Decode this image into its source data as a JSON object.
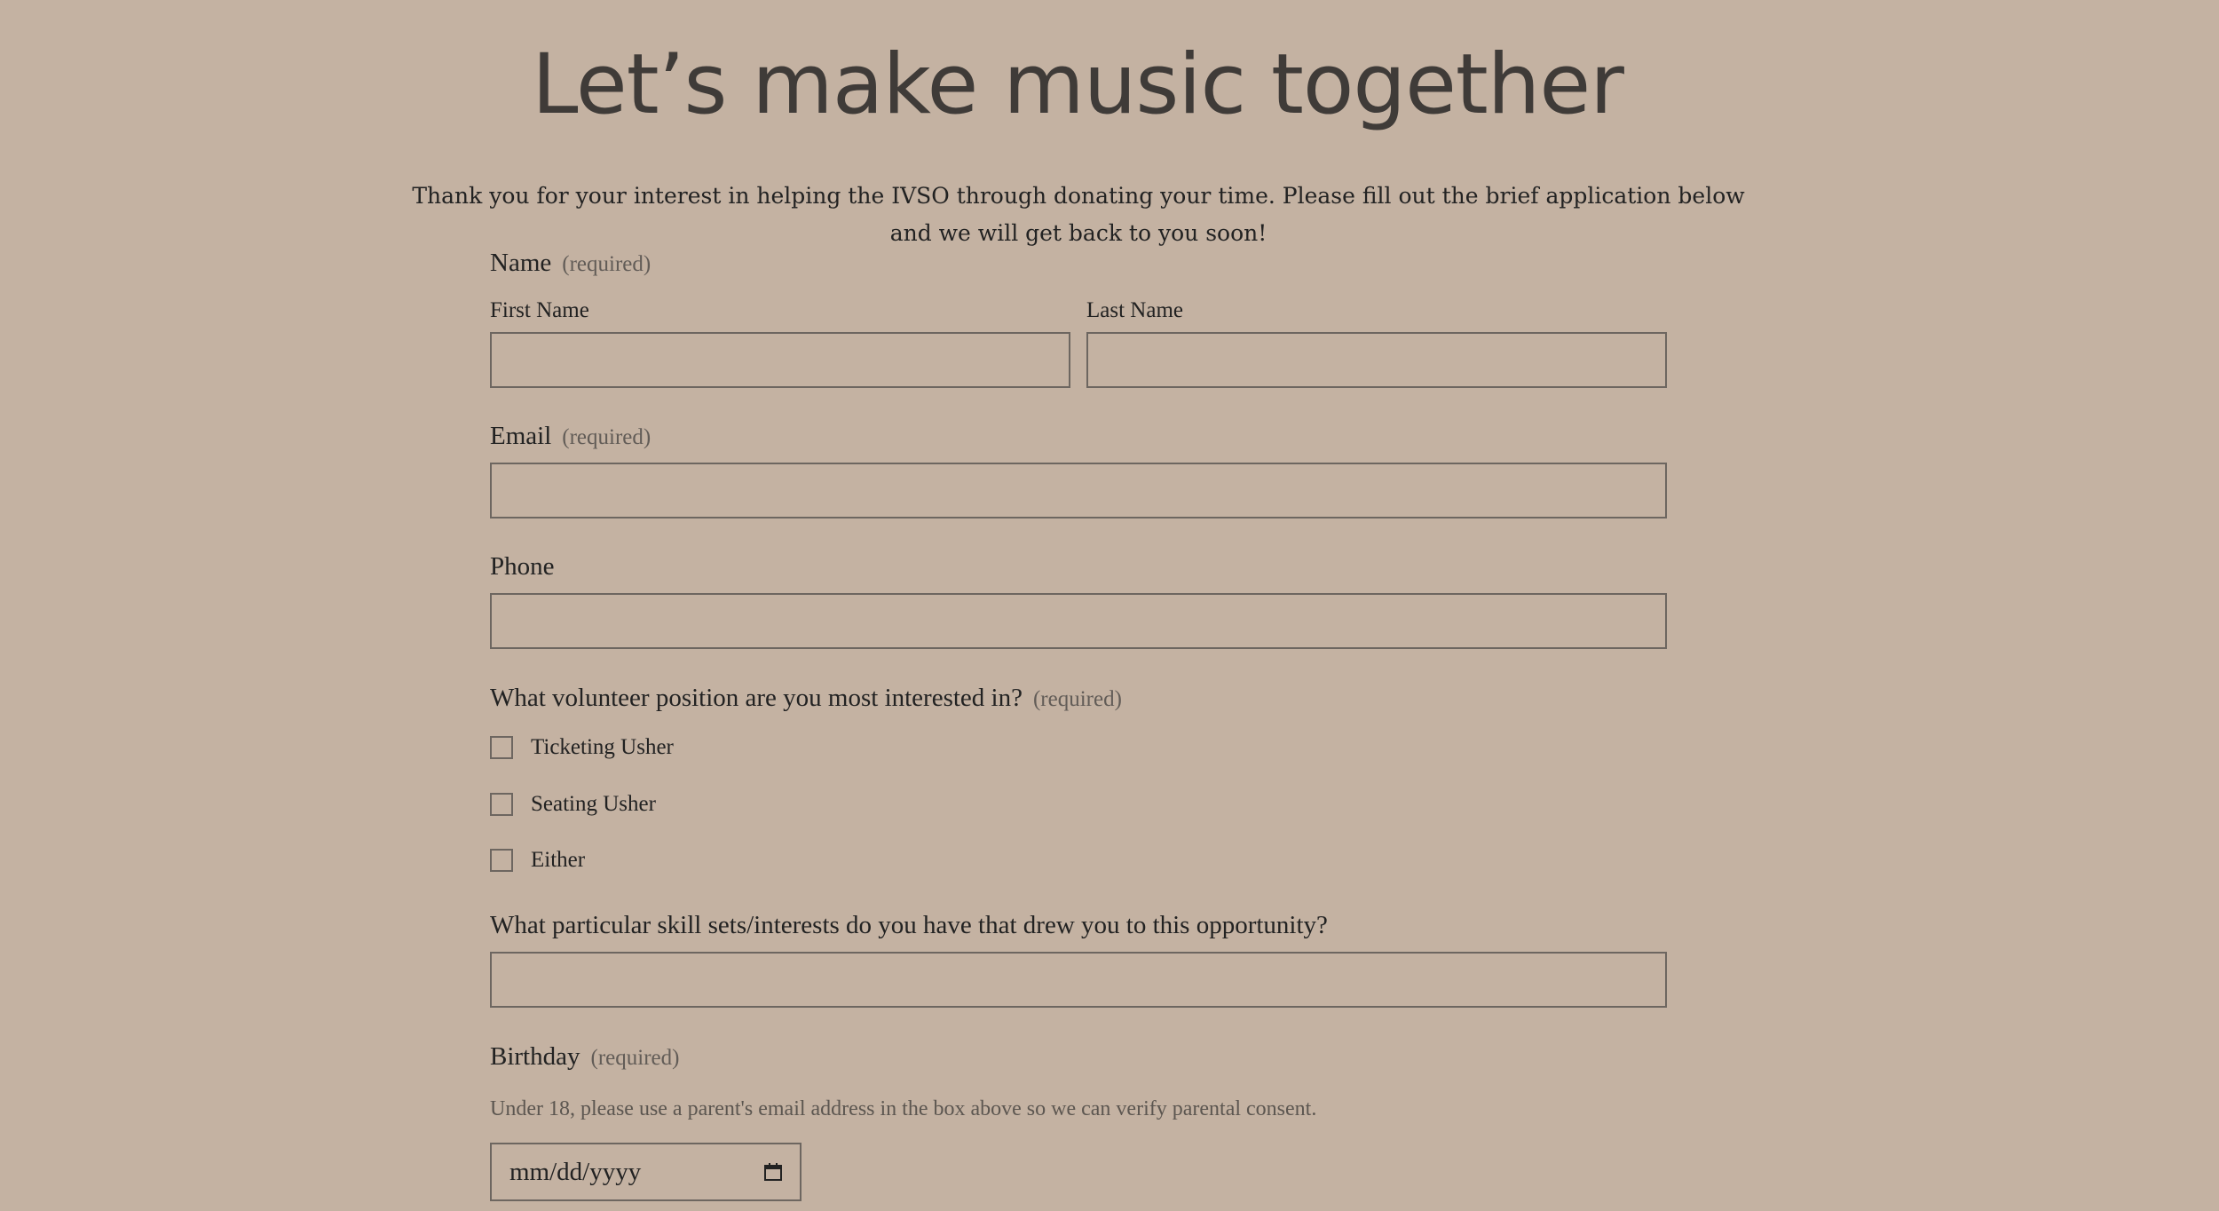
{
  "page": {
    "title": "Let’s make music together",
    "intro": "Thank you for your interest in helping the IVSO through donating your time. Please fill out the brief application below and we will get back to you soon!"
  },
  "form": {
    "required_text": "(required)",
    "name": {
      "label": "Name",
      "first_label": "First Name",
      "first_value": "",
      "last_label": "Last Name",
      "last_value": ""
    },
    "email": {
      "label": "Email",
      "value": ""
    },
    "phone": {
      "label": "Phone",
      "value": ""
    },
    "position": {
      "label": "What volunteer position are you most interested in?",
      "options": [
        {
          "label": "Ticketing Usher",
          "checked": false
        },
        {
          "label": "Seating Usher",
          "checked": false
        },
        {
          "label": "Either",
          "checked": false
        }
      ]
    },
    "skills": {
      "label": "What particular skill sets/interests do you have that drew you to this opportunity?",
      "value": ""
    },
    "birthday": {
      "label": "Birthday",
      "help": "Under 18, please use a parent's email address in the box above so we can verify parental consent.",
      "placeholder": "mm/dd/yyyy",
      "icon": "calendar-icon"
    }
  }
}
